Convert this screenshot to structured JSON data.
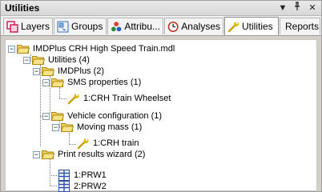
{
  "window": {
    "title": "Utilities",
    "controls": {
      "menu": "▼",
      "pin": "ᵽ",
      "close": "✕"
    }
  },
  "tabs": [
    {
      "label": "Layers",
      "icon": "layers-icon"
    },
    {
      "label": "Groups",
      "icon": "groups-icon"
    },
    {
      "label": "Attribu...",
      "icon": "attributes-icon"
    },
    {
      "label": "Analyses",
      "icon": "analyses-icon"
    },
    {
      "label": "Utilities",
      "icon": "utilities-icon",
      "active": true
    },
    {
      "label": "Reports",
      "icon": "reports-icon"
    }
  ],
  "tree": {
    "root": {
      "label": "IMDPlus CRH High Speed Train.mdl",
      "expanded": true
    },
    "utilities": {
      "label": "Utilities (4)",
      "expanded": true
    },
    "imdplus": {
      "label": "IMDPlus (2)",
      "expanded": true
    },
    "sms": {
      "label": "SMS properties (1)",
      "expanded": true
    },
    "sms_item": {
      "label": "1:CRH Train Wheelset",
      "icon": "wrench-icon"
    },
    "vehicle": {
      "label": "Vehicle configuration (1)",
      "expanded": true
    },
    "moving": {
      "label": "Moving mass (1)",
      "expanded": true
    },
    "moving_item": {
      "label": "1:CRH train",
      "icon": "wrench-icon"
    },
    "print": {
      "label": "Print results wizard (2)",
      "expanded": true
    },
    "prw1": {
      "label": "1:PRW1",
      "icon": "report-icon"
    },
    "prw2": {
      "label": "2:PRW2",
      "icon": "report-icon"
    }
  },
  "colors": {
    "folder": "#f0d060",
    "folder_dark": "#b08a10",
    "wrench": "#e0b800",
    "report": "#2a4fb0"
  }
}
